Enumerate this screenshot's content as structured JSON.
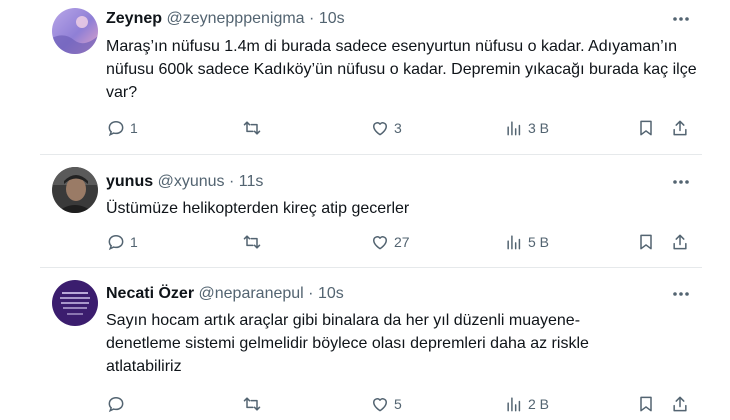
{
  "tweets": [
    {
      "name": "Zeynep",
      "handle": "@zeynepppenigma",
      "time": "10s",
      "text": "Maraş’ın nüfusu 1.4m di burada sadece esenyurtun nüfusu o kadar. Adıyaman’ın nüfusu 600k sadece Kadıköy’ün nüfusu o kadar. Depremin yıkacağı burada kaç ilçe var?",
      "replies": "1",
      "retweets": "",
      "likes": "3",
      "views": "3 B"
    },
    {
      "name": "yunus",
      "handle": "@xyunus",
      "time": "11s",
      "text": "Üstümüze helikopterden kireç atip gecerler",
      "replies": "1",
      "retweets": "",
      "likes": "27",
      "views": "5 B"
    },
    {
      "name": "Necati Özer",
      "handle": "@neparanepul",
      "time": "10s",
      "text": "Sayın hocam artık araçlar gibi binalara da her yıl düzenli muayene-denetleme sistemi gelmelidir böylece olası depremleri daha az riskle atlatabiliriz",
      "replies": "",
      "retweets": "",
      "likes": "5",
      "views": "2 B"
    }
  ],
  "colors": {
    "text": "#0f1419",
    "secondary": "#536471",
    "divider": "#e6e9eb"
  },
  "icons": [
    "more-icon",
    "reply-icon",
    "retweet-icon",
    "like-icon",
    "views-icon",
    "bookmark-icon",
    "share-icon"
  ]
}
